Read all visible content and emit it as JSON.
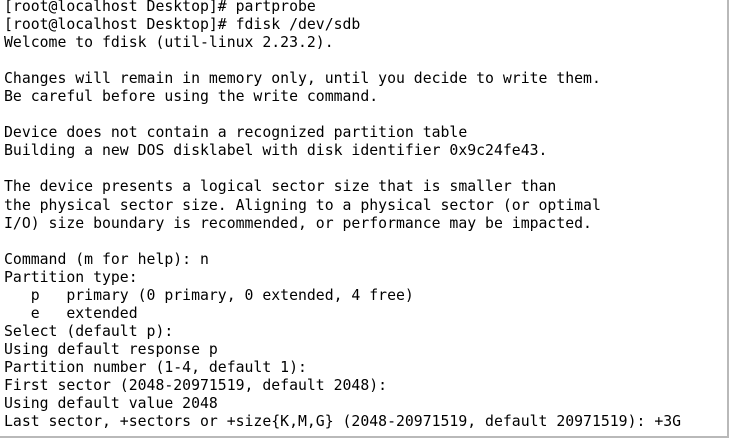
{
  "terminal": {
    "lines": [
      "[root@localhost Desktop]# partprobe",
      "[root@localhost Desktop]# fdisk /dev/sdb",
      "Welcome to fdisk (util-linux 2.23.2).",
      "",
      "Changes will remain in memory only, until you decide to write them.",
      "Be careful before using the write command.",
      "",
      "Device does not contain a recognized partition table",
      "Building a new DOS disklabel with disk identifier 0x9c24fe43.",
      "",
      "The device presents a logical sector size that is smaller than",
      "the physical sector size. Aligning to a physical sector (or optimal",
      "I/O) size boundary is recommended, or performance may be impacted.",
      "",
      "Command (m for help): n",
      "Partition type:",
      "   p   primary (0 primary, 0 extended, 4 free)",
      "   e   extended",
      "Select (default p):",
      "Using default response p",
      "Partition number (1-4, default 1):",
      "First sector (2048-20971519, default 2048):",
      "Using default value 2048",
      "Last sector, +sectors or +size{K,M,G} (2048-20971519, default 20971519): +3G"
    ]
  }
}
